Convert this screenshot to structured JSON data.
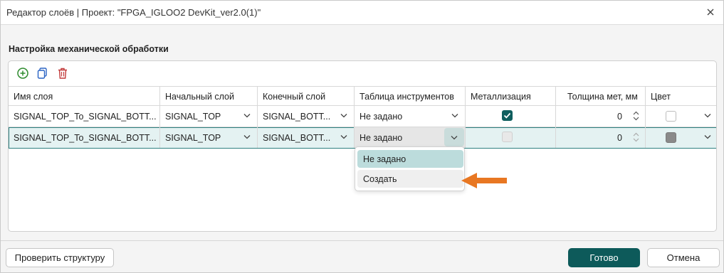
{
  "window": {
    "title": "Редактор слоёв | Проект: \"FPGA_IGLOO2 DevKit_ver2.0(1)\""
  },
  "section": {
    "title": "Настройка механической обработки"
  },
  "toolbar": {
    "icons": [
      "add-circle-icon",
      "copy-icon",
      "trash-icon"
    ]
  },
  "table": {
    "columns": [
      "Имя слоя",
      "Начальный слой",
      "Конечный слой",
      "Таблица инструментов",
      "Металлизация",
      "Толщина мет, мм",
      "Цвет"
    ],
    "rows": [
      {
        "name": "SIGNAL_TOP_To_SIGNAL_BOTT...",
        "start": "SIGNAL_TOP",
        "end": "SIGNAL_BOTT...",
        "tools": "Не задано",
        "plating": true,
        "thickness": "0",
        "color": "#ffffff",
        "enabled": true,
        "selected": false
      },
      {
        "name": "SIGNAL_TOP_To_SIGNAL_BOTT...",
        "start": "SIGNAL_TOP",
        "end": "SIGNAL_BOTT...",
        "tools": "Не задано",
        "plating": false,
        "thickness": "0",
        "color": "#8a8a8a",
        "enabled": false,
        "selected": true
      }
    ]
  },
  "dropdown": {
    "options": [
      "Не задано",
      "Создать"
    ],
    "selected": "Не задано",
    "hovered": "Создать"
  },
  "footer": {
    "check_label": "Проверить структуру",
    "ok_label": "Готово",
    "cancel_label": "Отмена"
  },
  "colors": {
    "accent": "#0d5a5a",
    "selection_row": "#e4f2f2",
    "annotation_arrow": "#e87722"
  }
}
